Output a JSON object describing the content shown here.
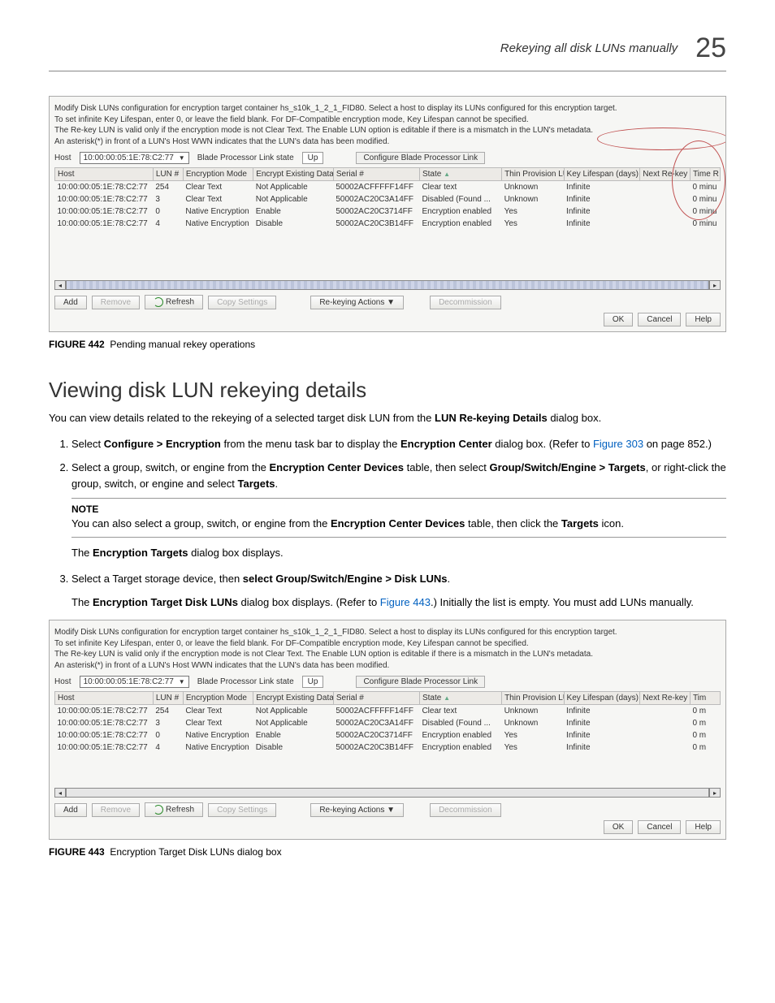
{
  "header": {
    "title": "Rekeying all disk LUNs manually",
    "chapter": "25"
  },
  "figure442": {
    "label": "FIGURE 442",
    "caption": "Pending manual rekey operations"
  },
  "figure443": {
    "label": "FIGURE 443",
    "caption": "Encryption Target Disk LUNs dialog box"
  },
  "section": {
    "heading": "Viewing disk LUN rekeying details"
  },
  "para1": {
    "t1": "You can view details related to the rekeying of a selected target disk LUN from the ",
    "b1": "LUN Re-keying Details",
    "t2": " dialog box."
  },
  "step1": {
    "t1": "Select ",
    "b1": "Configure > Encryption",
    "t2": " from the menu task bar to display the ",
    "b2": "Encryption Center",
    "t3": " dialog box. (Refer to ",
    "link": "Figure 303",
    "t4": " on page 852.)"
  },
  "step2": {
    "t1": "Select a group, switch, or engine from the ",
    "b1": "Encryption Center Devices",
    "t2": " table, then select ",
    "b2": "Group/Switch/Engine > Targets",
    "t3": ", or right-click the group, switch, or engine and select ",
    "b3": "Targets",
    "t4": "."
  },
  "note": {
    "hdr": "NOTE",
    "t1": "You can also select a group, switch, or engine from the ",
    "b1": "Encryption Center Devices",
    "t2": " table, then click the ",
    "b2": "Targets",
    "t3": " icon."
  },
  "aftern1": {
    "t1": "The ",
    "b1": "Encryption Targets",
    "t2": " dialog box displays."
  },
  "step3": {
    "t1": "Select a Target storage device, then ",
    "b1": "select Group/Switch/Engine > Disk LUNs",
    "t2": "."
  },
  "aftern2": {
    "t1": "The ",
    "b1": "Encryption Target Disk LUNs",
    "t2": " dialog box displays. (Refer to ",
    "link": "Figure 443",
    "t3": ".) Initially the list is empty. You must add LUNs manually."
  },
  "dlg": {
    "intro1": "Modify Disk LUNs configuration for encryption target container hs_s10k_1_2_1_FID80. Select a host to display its LUNs configured for this encryption target.",
    "intro2": "To set infinite Key Lifespan, enter 0, or leave the field blank. For DF-Compatible encryption mode, Key Lifespan cannot be specified.",
    "intro3": "The Re-key LUN is valid only if the encryption mode is not Clear Text. The Enable LUN option is editable if there is a mismatch in the LUN's metadata.",
    "intro4": "An asterisk(*) in front of a LUN's Host WWN indicates that the LUN's data has been modified.",
    "hostlbl": "Host",
    "hostval": "10:00:00:05:1E:78:C2:77",
    "bpstate_lbl": "Blade Processor Link state",
    "bpstate_val": "Up",
    "cfg_bp": "Configure Blade Processor Link",
    "cols": {
      "host": "Host",
      "lun": "LUN #",
      "enc": "Encryption Mode",
      "exi": "Encrypt Existing Data",
      "ser": "Serial #",
      "state": "State",
      "thin": "Thin Provision LUN",
      "life": "Key Lifespan (days)",
      "next": "Next Re-key",
      "timeA": "Time R",
      "timeB": "Tim"
    }
  },
  "table1Tail": [
    "0 minu",
    "0 minu",
    "0 minu",
    "0 minu"
  ],
  "table2Tail": [
    "0 m",
    "0 m",
    "0 m",
    "0 m"
  ],
  "rows": [
    {
      "host": "10:00:00:05:1E:78:C2:77",
      "lun": "254",
      "enc": "Clear Text",
      "exi": "Not Applicable",
      "ser": "50002ACFFFFF14FF",
      "state": "Clear text",
      "thin": "Unknown",
      "life": "Infinite",
      "next": ""
    },
    {
      "host": "10:00:00:05:1E:78:C2:77",
      "lun": "3",
      "enc": "Clear Text",
      "exi": "Not Applicable",
      "ser": "50002AC20C3A14FF",
      "state": "Disabled (Found ...",
      "thin": "Unknown",
      "life": "Infinite",
      "next": ""
    },
    {
      "host": "10:00:00:05:1E:78:C2:77",
      "lun": "0",
      "enc": "Native Encryption",
      "exi": "Enable",
      "ser": "50002AC20C3714FF",
      "state": "Encryption enabled",
      "thin": "Yes",
      "life": "Infinite",
      "next": ""
    },
    {
      "host": "10:00:00:05:1E:78:C2:77",
      "lun": "4",
      "enc": "Native Encryption",
      "exi": "Disable",
      "ser": "50002AC20C3B14FF",
      "state": "Encryption enabled",
      "thin": "Yes",
      "life": "Infinite",
      "next": ""
    }
  ],
  "btns": {
    "add": "Add",
    "remove": "Remove",
    "refresh": "Refresh",
    "copy": "Copy Settings",
    "rekey": "Re-keying Actions",
    "decom": "Decommission",
    "ok": "OK",
    "cancel": "Cancel",
    "help": "Help"
  }
}
